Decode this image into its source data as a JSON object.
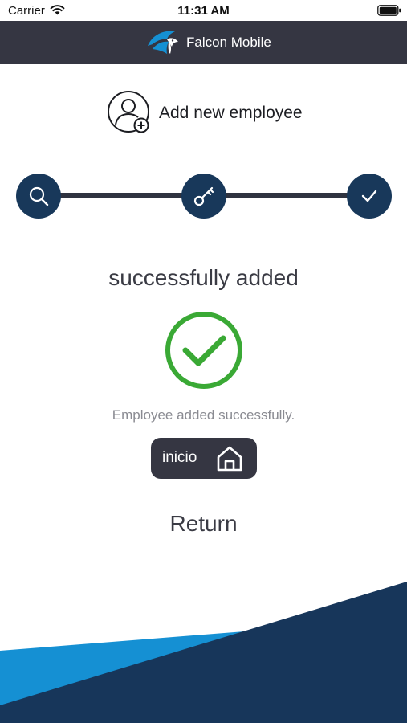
{
  "status_bar": {
    "carrier": "Carrier",
    "time": "11:31 AM"
  },
  "navbar": {
    "title": "Falcon Mobile",
    "logo_icon": "falcon-logo-icon"
  },
  "header": {
    "title": "Add new employee",
    "icon": "add-user-icon"
  },
  "stepper": {
    "steps": [
      {
        "icon": "search-icon",
        "state": "completed"
      },
      {
        "icon": "key-icon",
        "state": "completed"
      },
      {
        "icon": "check-icon",
        "state": "current"
      }
    ]
  },
  "result": {
    "title": "successfully added",
    "icon": "success-check-icon",
    "message": "Employee added successfully."
  },
  "home_button": {
    "label": "inicio",
    "icon": "home-icon"
  },
  "return_link": {
    "label": "Return"
  },
  "colors": {
    "navbar": "#353642",
    "step_circle": "#18385a",
    "success_green": "#3aa935",
    "footer_light_blue": "#1590d3",
    "footer_dark_blue": "#17365a"
  }
}
